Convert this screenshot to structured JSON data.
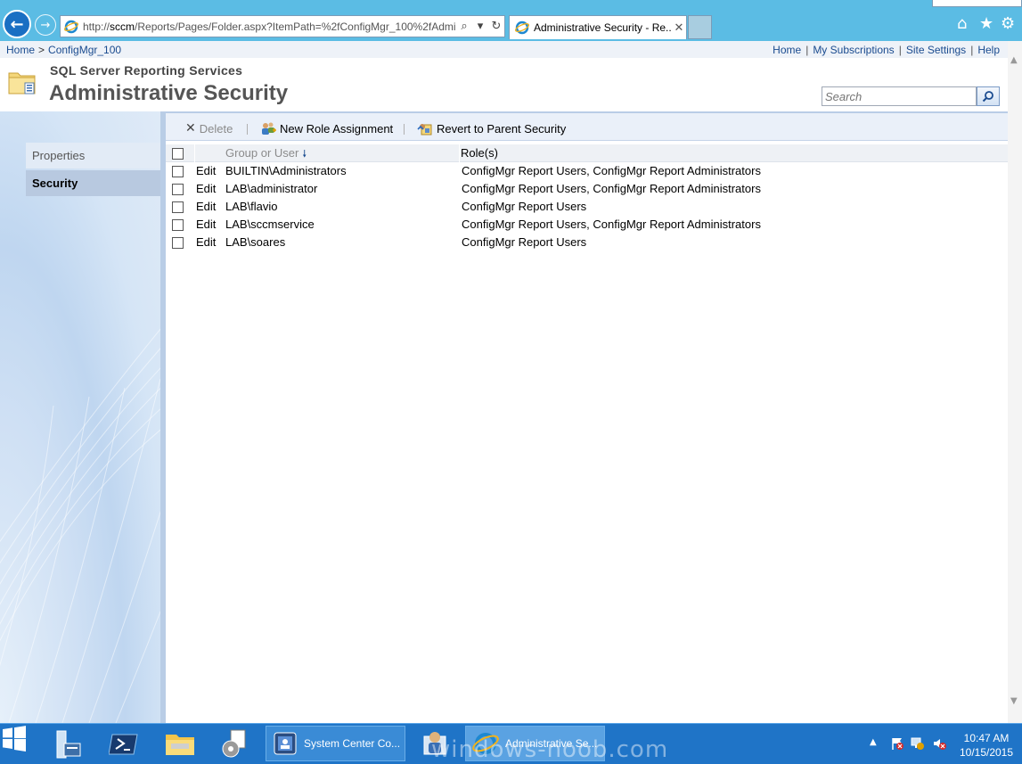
{
  "browser": {
    "address_prefix": "http://",
    "address_host": "sccm",
    "address_rest": "/Reports/Pages/Folder.aspx?ItemPath=%2fConfigMgr_100%2fAdmi",
    "tab_title": "Administrative Security - Re..."
  },
  "breadcrumb": {
    "home": "Home",
    "sep": ">",
    "folder": "ConfigMgr_100"
  },
  "global_links": [
    "Home",
    "My Subscriptions",
    "Site Settings",
    "Help"
  ],
  "header": {
    "app_name": "SQL Server Reporting Services",
    "title": "Administrative Security",
    "search_placeholder": "Search"
  },
  "left_tabs": {
    "properties": "Properties",
    "security": "Security"
  },
  "toolbar": {
    "delete": "Delete",
    "new_role": "New Role Assignment",
    "revert": "Revert to Parent Security"
  },
  "table": {
    "col_user": "Group or User",
    "col_roles": "Role(s)",
    "edit_label": "Edit",
    "rows": [
      {
        "user": "BUILTIN\\Administrators",
        "roles": "ConfigMgr Report Users, ConfigMgr Report Administrators"
      },
      {
        "user": "LAB\\administrator",
        "roles": "ConfigMgr Report Users, ConfigMgr Report Administrators"
      },
      {
        "user": "LAB\\flavio",
        "roles": "ConfigMgr Report Users"
      },
      {
        "user": "LAB\\sccmservice",
        "roles": "ConfigMgr Report Users, ConfigMgr Report Administrators"
      },
      {
        "user": "LAB\\soares",
        "roles": "ConfigMgr Report Users"
      }
    ]
  },
  "taskbar": {
    "apps": [
      {
        "label": "System Center Co..."
      },
      {
        "label": "Administrative Se..."
      }
    ],
    "time": "10:47 AM",
    "date": "10/15/2015",
    "watermark": "windows-noob.com"
  },
  "colors": {
    "browser_bar": "#5bbce4",
    "taskbar": "#1f74c7",
    "link": "#1a4b8f",
    "selected_tab": "#b8c9e0"
  }
}
